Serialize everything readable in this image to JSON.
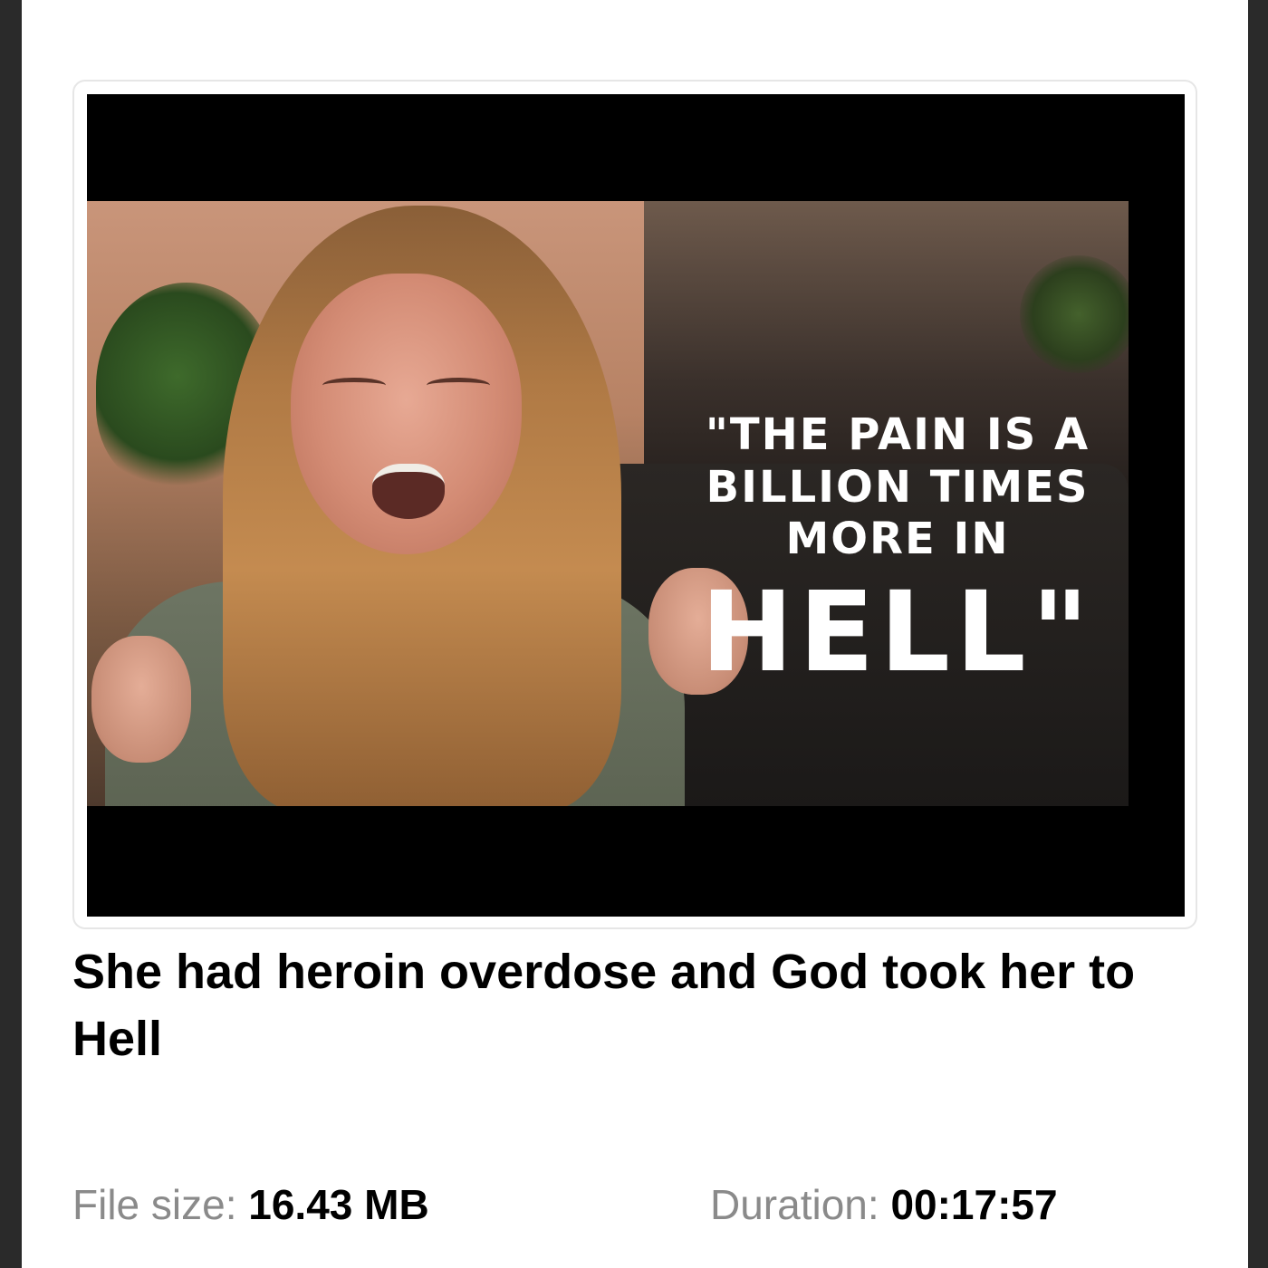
{
  "thumbnail": {
    "caption_lines": [
      "\"THE PAIN IS A",
      "BILLION TIMES",
      "MORE IN"
    ],
    "caption_big": "HELL\""
  },
  "video": {
    "title": "She had heroin overdose and God took her to Hell"
  },
  "meta": {
    "file_size_label": "File size:",
    "file_size_value": "16.43 MB",
    "duration_label": "Duration:",
    "duration_value": "00:17:57"
  }
}
